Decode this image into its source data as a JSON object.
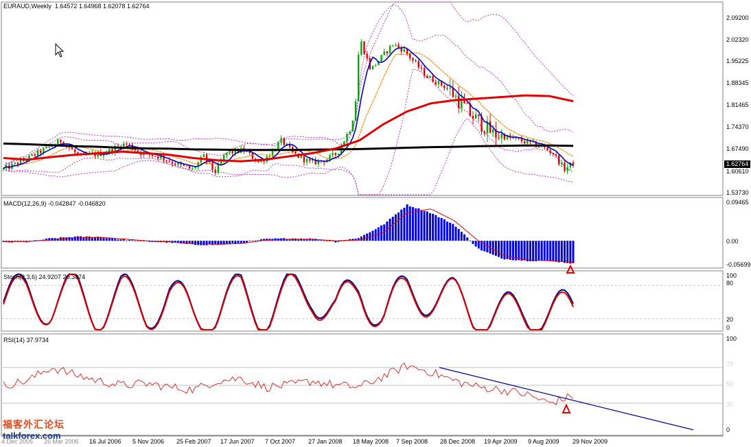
{
  "chart_data": [
    {
      "type": "candlestick",
      "title": "EURAUD,Weekly",
      "ohlc_text": "1.64572 1.64968 1.62078 1.62764",
      "current_price": "1.62764",
      "yticks": [
        "2.09200",
        "2.02320",
        "1.95225",
        "1.88345",
        "1.81465",
        "1.74370",
        "1.67490",
        "1.60610",
        "1.53730"
      ],
      "ylim": [
        1.5373,
        2.092
      ],
      "series": [
        {
          "name": "",
          "color": "#000000",
          "values": [
            1.69,
            1.688,
            1.685,
            1.682,
            1.68,
            1.677,
            1.675,
            1.674,
            1.672,
            1.671,
            1.67,
            1.67,
            1.67,
            1.671,
            1.672,
            1.673,
            1.675,
            1.677,
            1.679,
            1.68,
            1.682,
            1.683,
            1.684,
            1.684,
            1.683
          ]
        },
        {
          "name": "",
          "color": "#e00000",
          "values": [
            1.645,
            1.64,
            1.648,
            1.655,
            1.66,
            1.665,
            1.66,
            1.655,
            1.645,
            1.638,
            1.635,
            1.64,
            1.65,
            1.66,
            1.675,
            1.7,
            1.75,
            1.79,
            1.815,
            1.825,
            1.83,
            1.835,
            1.84,
            1.838,
            1.822
          ]
        }
      ],
      "grid": false
    },
    {
      "type": "bar",
      "title": "MACD(12,26,9) -0.042847 -0.046820",
      "yticks": [
        "0.09465",
        "0.00",
        "-0.05699"
      ],
      "ylim": [
        -0.065,
        0.1
      ],
      "values": [
        -0.004,
        -0.003,
        0.006,
        0.01,
        0.01,
        0.003,
        -0.002,
        -0.004,
        -0.01,
        -0.01,
        -0.006,
        0.004,
        0.006,
        0.005,
        -0.003,
        0.008,
        0.04,
        0.09,
        0.07,
        0.04,
        -0.02,
        -0.045,
        -0.05,
        -0.05,
        -0.057
      ],
      "signal": [
        -0.002,
        -0.002,
        0.002,
        0.007,
        0.009,
        0.005,
        0.0,
        -0.003,
        -0.007,
        -0.009,
        -0.007,
        0.001,
        0.004,
        0.004,
        0.0,
        0.002,
        0.02,
        0.07,
        0.08,
        0.05,
        0.0,
        -0.035,
        -0.048,
        -0.05,
        -0.054
      ]
    },
    {
      "type": "line",
      "title": "Stoch(9,3,6) 24.9207 20.3874",
      "yticks": [
        "100",
        "80",
        "20",
        "0"
      ],
      "ylim": [
        0,
        100
      ],
      "levels": [
        80,
        20
      ],
      "series": [
        {
          "name": "",
          "color": "#000080",
          "values": [
            50,
            80,
            40,
            85,
            20,
            75,
            25,
            70,
            15,
            20,
            80,
            10,
            75,
            85,
            20,
            90,
            15,
            80,
            75,
            55,
            10,
            10,
            25,
            15,
            24.9
          ]
        },
        {
          "name": "",
          "color": "#e00000",
          "values": [
            48,
            78,
            45,
            82,
            25,
            72,
            28,
            68,
            18,
            22,
            78,
            12,
            72,
            83,
            22,
            88,
            18,
            78,
            76,
            58,
            12,
            11,
            23,
            16,
            20.4
          ]
        }
      ]
    },
    {
      "type": "line",
      "title": "RSI(14) 37.9734",
      "yticks": [
        "100",
        "70",
        "50",
        "30",
        "0"
      ],
      "ylim": [
        0,
        100
      ],
      "levels": [
        70,
        50,
        30
      ],
      "series": [
        {
          "name": "",
          "color": "#e00000",
          "values": [
            50,
            55,
            70,
            62,
            55,
            50,
            52,
            48,
            45,
            55,
            58,
            48,
            50,
            55,
            50,
            48,
            60,
            72,
            65,
            55,
            48,
            45,
            40,
            30,
            38
          ]
        }
      ]
    }
  ],
  "xaxis_dates": [
    "4 Dec 2005",
    "26 Mar 2006",
    "16 Jul 2006",
    "5 Nov 2006",
    "25 Feb 2007",
    "17 Jun 2007",
    "7 Oct 2007",
    "27 Jan 2008",
    "18 May 2008",
    "7 Sep 2008",
    "28 Dec 2008",
    "19 Apr 2009",
    "9 Aug 2009",
    "29 Nov 2009"
  ],
  "watermark": {
    "line1": "福客外汇论坛",
    "line2": "talkforex.com"
  },
  "colors": {
    "up": "#00aa00",
    "down": "#e00000",
    "bb": "#b000b0",
    "macd_hist": "#0000e0",
    "ma_fast": "#0000c0",
    "ma_mid": "#ff8000",
    "trendline": "#0000a0",
    "arrow": "#e00000"
  }
}
